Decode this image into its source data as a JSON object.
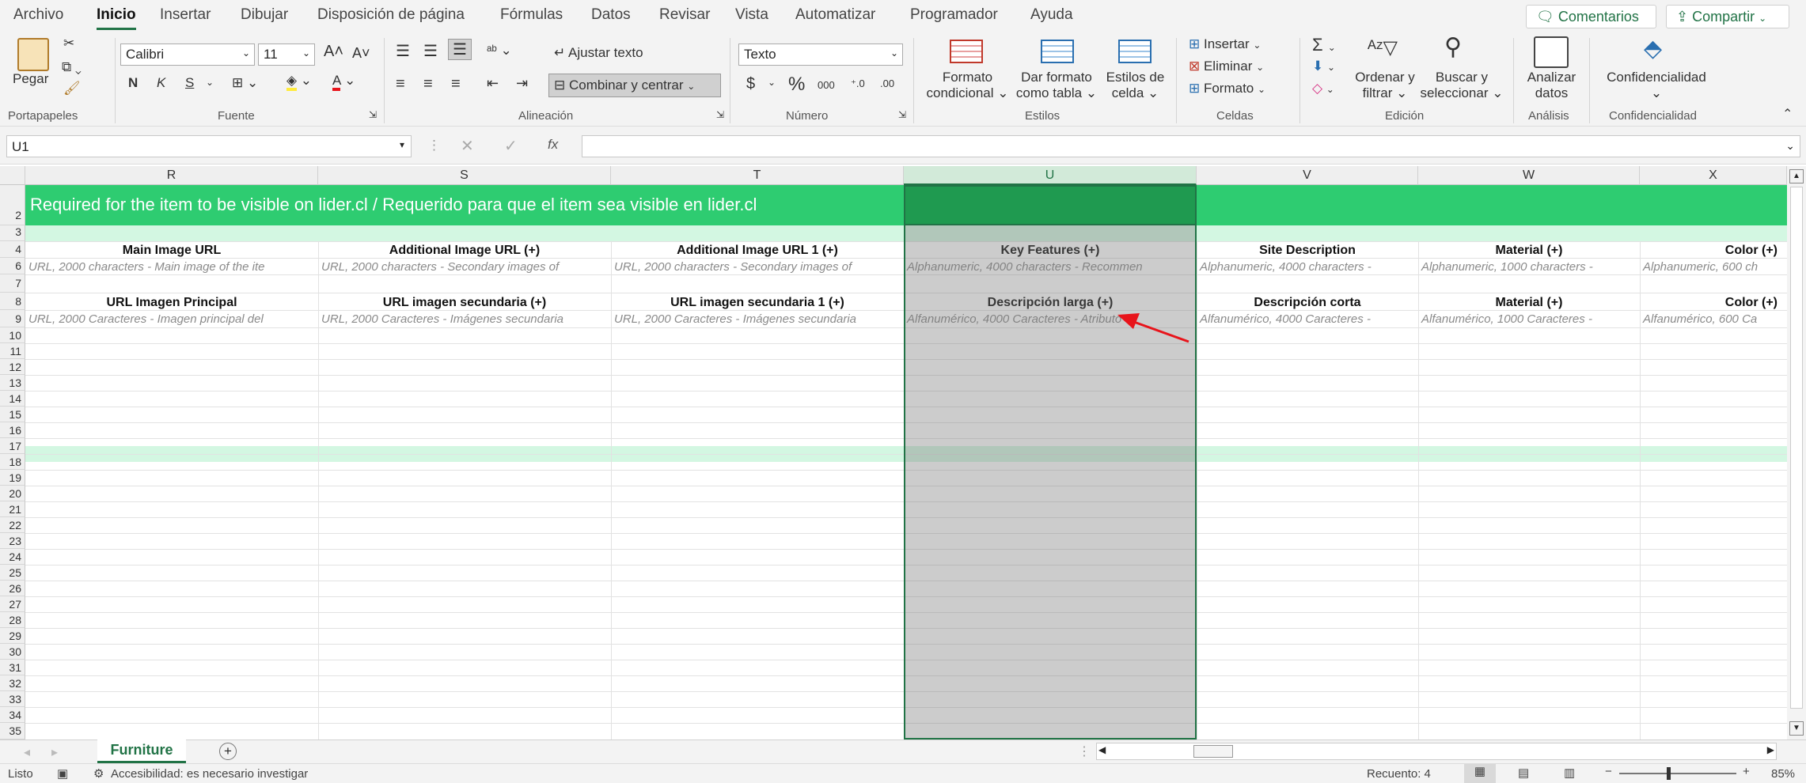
{
  "menu": {
    "tabs": [
      "Archivo",
      "Inicio",
      "Insertar",
      "Dibujar",
      "Disposición de página",
      "Fórmulas",
      "Datos",
      "Revisar",
      "Vista",
      "Automatizar",
      "Programador",
      "Ayuda"
    ],
    "comments_label": "Comentarios",
    "share_label": "Compartir"
  },
  "ribbon": {
    "clipboard": {
      "paste_label": "Pegar",
      "group": "Portapapeles"
    },
    "font": {
      "name": "Calibri",
      "size": "11",
      "bold": "N",
      "italic": "K",
      "underline": "S",
      "group": "Fuente"
    },
    "alignment": {
      "wrap_label": "Ajustar texto",
      "merge_label": "Combinar y centrar",
      "group": "Alineación"
    },
    "number": {
      "format": "Texto",
      "currency": "$",
      "percent": "%",
      "thousands": "000",
      "group": "Número"
    },
    "styles": {
      "cond_format_1": "Formato",
      "cond_format_2": "condicional",
      "table_1": "Dar formato",
      "table_2": "como tabla",
      "cell_styles_1": "Estilos de",
      "cell_styles_2": "celda",
      "group": "Estilos"
    },
    "cells": {
      "insert": "Insertar",
      "delete": "Eliminar",
      "format": "Formato",
      "group": "Celdas"
    },
    "editing": {
      "sort_1": "Ordenar y",
      "sort_2": "filtrar",
      "find_1": "Buscar y",
      "find_2": "seleccionar",
      "group": "Edición"
    },
    "analysis": {
      "analyze_1": "Analizar",
      "analyze_2": "datos",
      "group": "Análisis"
    },
    "privacy": {
      "label": "Confidencialidad",
      "group": "Confidencialidad"
    }
  },
  "formula_bar": {
    "name_box": "U1",
    "fx": "fx",
    "formula": ""
  },
  "columns": [
    "R",
    "S",
    "T",
    "U",
    "V",
    "W",
    "X"
  ],
  "rows": [
    "2",
    "3",
    "4",
    "6",
    "7",
    "8",
    "9",
    "10",
    "11",
    "12",
    "13",
    "14",
    "15",
    "16",
    "17",
    "18",
    "19",
    "20",
    "21",
    "22",
    "23",
    "24",
    "25",
    "26",
    "27",
    "28",
    "29",
    "30",
    "31",
    "32",
    "33",
    "34",
    "35"
  ],
  "banner_text": "Required for the item to be visible on lider.cl / Requerido para que el item sea visible en lider.cl",
  "headers_en": [
    "Main Image URL",
    "Additional Image URL (+)",
    "Additional Image URL 1 (+)",
    "Key Features (+)",
    "Site Description",
    "Material (+)",
    "Color (+)"
  ],
  "desc_en": [
    "URL, 2000 characters - Main image of the ite",
    "URL, 2000 characters - Secondary images of",
    "URL, 2000 characters - Secondary images of",
    "Alphanumeric, 4000 characters - Recommen",
    "Alphanumeric, 4000 characters -",
    "Alphanumeric, 1000 characters -",
    "Alphanumeric, 600 ch"
  ],
  "headers_es": [
    "URL Imagen Principal",
    "URL imagen secundaria (+)",
    "URL imagen secundaria 1 (+)",
    "Descripción larga (+)",
    "Descripción corta",
    "Material (+)",
    "Color (+)"
  ],
  "desc_es": [
    "URL, 2000 Caracteres - Imagen principal del",
    "URL, 2000 Caracteres - Imágenes secundaria",
    "URL, 2000 Caracteres - Imágenes secundaria",
    "Alfanumérico, 4000 Caracteres - Atributo di",
    "Alfanumérico, 4000 Caracteres -",
    "Alfanumérico, 1000 Caracteres -",
    "Alfanumérico, 600 Ca"
  ],
  "sheet_tab": "Furniture",
  "status": {
    "ready": "Listo",
    "accessibility": "Accesibilidad: es necesario investigar",
    "count": "Recuento: 4",
    "zoom": "85%"
  },
  "colors": {
    "accent": "#217346",
    "banner": "#2ecc71",
    "light_band": "#d3f7e2",
    "arrow": "#e8141b"
  }
}
